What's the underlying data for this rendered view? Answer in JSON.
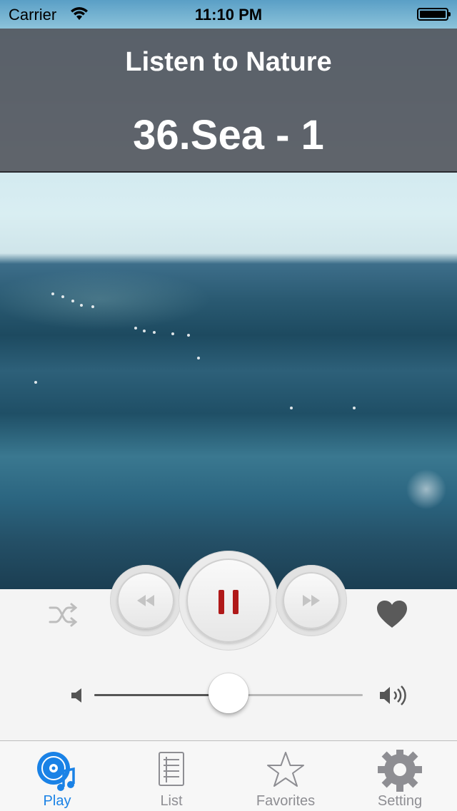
{
  "status_bar": {
    "carrier": "Carrier",
    "time": "11:10 PM",
    "wifi_icon": "wifi-icon",
    "battery_icon": "battery-icon"
  },
  "header": {
    "app_title": "Listen to Nature",
    "track_title": "36.Sea - 1"
  },
  "player": {
    "shuffle_icon": "shuffle-icon",
    "rewind_icon": "rewind-icon",
    "pause_icon": "pause-icon",
    "fast_forward_icon": "fast-forward-icon",
    "favorite_icon": "heart-icon",
    "volume": 0.5,
    "volume_low_icon": "speaker-low-icon",
    "volume_high_icon": "speaker-high-icon",
    "accent_color": "#b01919"
  },
  "tabbar": {
    "active_color": "#1a82e6",
    "inactive_color": "#8e8e93",
    "tabs": [
      {
        "label": "Play",
        "icon": "play-disc-icon",
        "active": true
      },
      {
        "label": "List",
        "icon": "list-icon",
        "active": false
      },
      {
        "label": "Favorites",
        "icon": "star-icon",
        "active": false
      },
      {
        "label": "Setting",
        "icon": "gear-icon",
        "active": false
      }
    ]
  }
}
